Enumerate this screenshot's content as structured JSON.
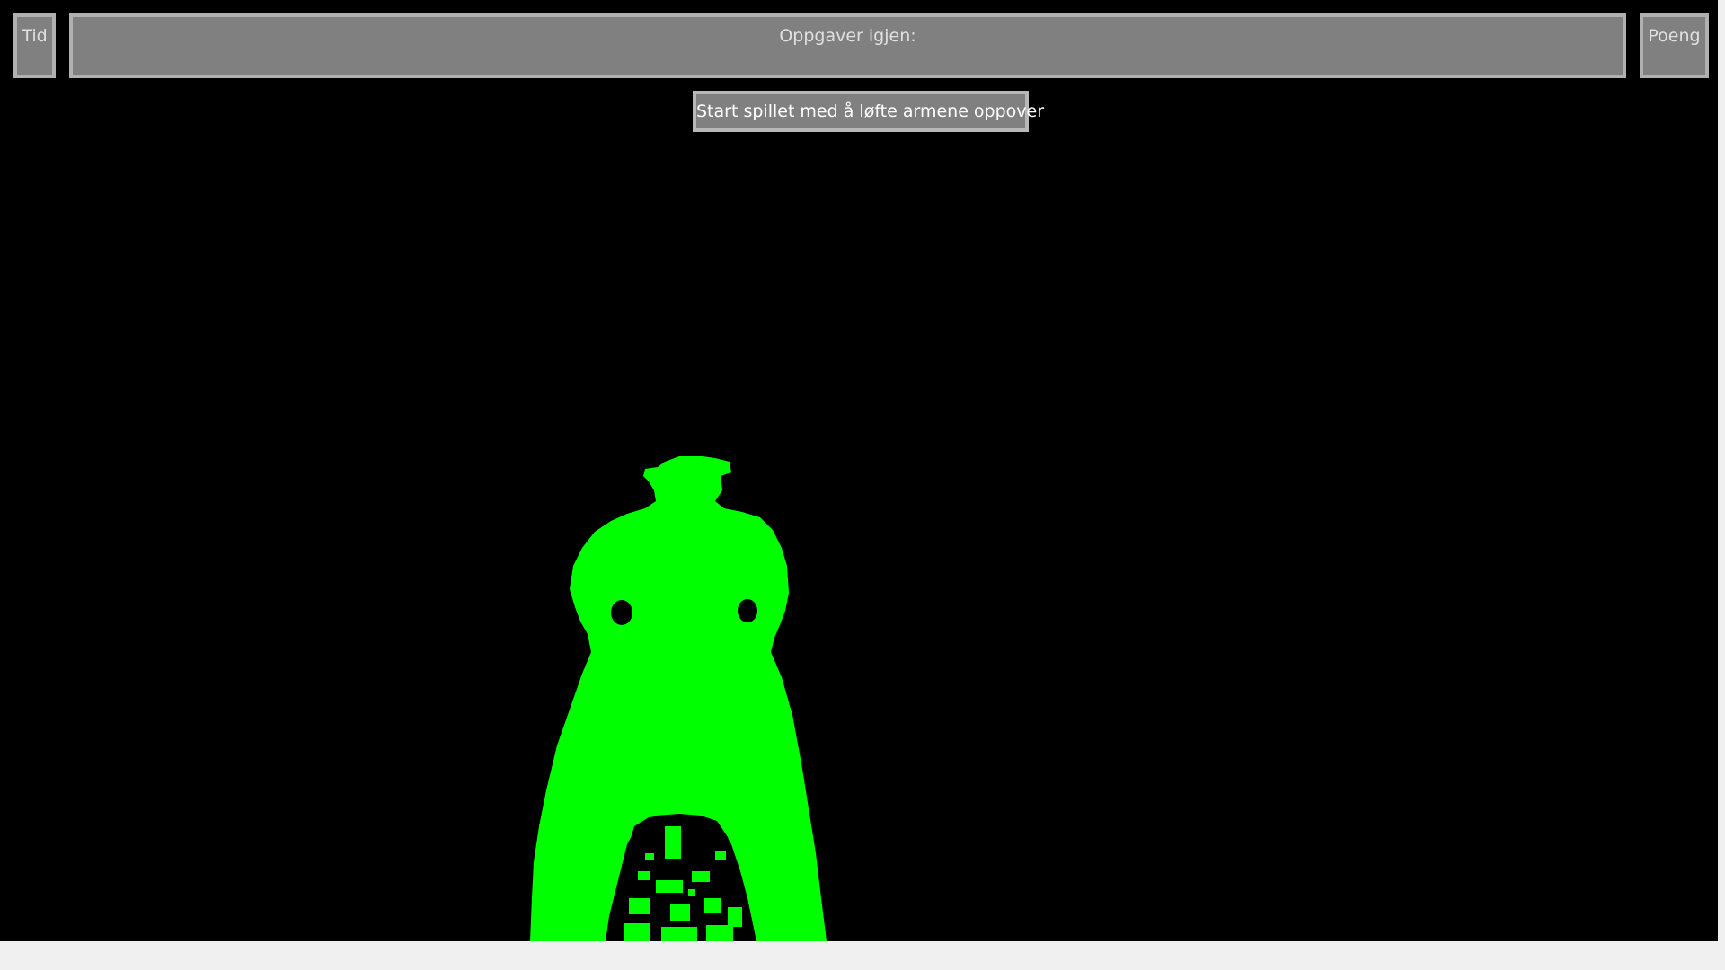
{
  "hud": {
    "time_label": "Tid",
    "tasks_label": "Oppgaver igjen:",
    "score_label": "Poeng"
  },
  "start_prompt": {
    "label": "Start spillet med å løfte armene oppover"
  },
  "camera_view": {
    "background_color": "#000000",
    "player_color": "#00ff00"
  }
}
